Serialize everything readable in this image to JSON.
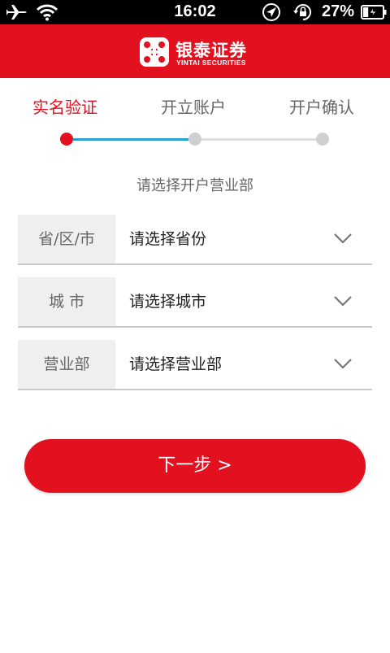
{
  "status_bar": {
    "time": "16:02",
    "battery_percent": "27%",
    "battery_level": 0.27
  },
  "header": {
    "brand_cn": "银泰证券",
    "brand_en": "YINTAI SECURITIES",
    "brand_color": "#e3101f"
  },
  "steps": [
    {
      "label": "实名验证",
      "state": "active"
    },
    {
      "label": "开立账户",
      "state": "pending"
    },
    {
      "label": "开户确认",
      "state": "pending"
    }
  ],
  "form": {
    "subtitle": "请选择开户营业部",
    "rows": [
      {
        "label": "省/区/市",
        "value": "请选择省份"
      },
      {
        "label": "城 市",
        "value": "请选择城市"
      },
      {
        "label": "营业部",
        "value": "请选择营业部"
      }
    ]
  },
  "actions": {
    "next_label": "下一步 >"
  },
  "colors": {
    "accent_red": "#e3101f",
    "progress_blue": "#2a9fd6",
    "inactive_gray": "#cfcfcf"
  }
}
